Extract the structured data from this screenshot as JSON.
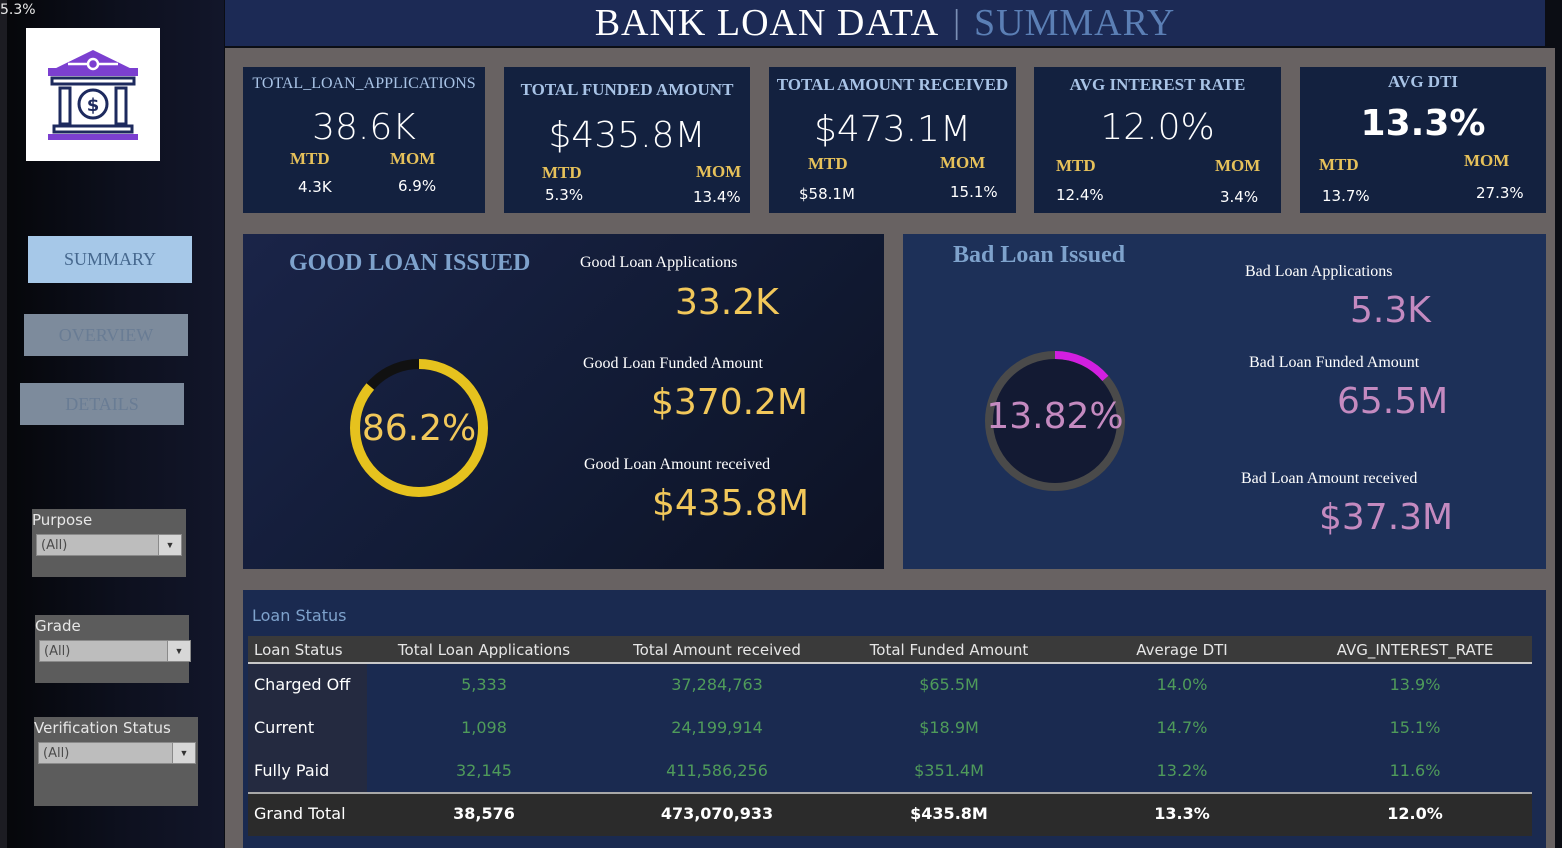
{
  "corner_text": "5.3%",
  "title": {
    "main": "BANK LOAN DATA",
    "separator": "|",
    "sub": "SUMMARY"
  },
  "nav": {
    "summary": "SUMMARY",
    "overview": "OVERVIEW",
    "details": "DETAILS"
  },
  "filters": [
    {
      "label": "Purpose",
      "value": "(All)"
    },
    {
      "label": "Grade",
      "value": "(All)"
    },
    {
      "label": "Verification Status",
      "value": "(All)"
    }
  ],
  "kpis": [
    {
      "title": "TOTAL_LOAN_APPLICATIONS",
      "value": "38.6K",
      "mtd_label": "MTD",
      "mom_label": "MOM",
      "mtd": "4.3K",
      "mom": "6.9%"
    },
    {
      "title": "TOTAL FUNDED AMOUNT",
      "value": "$435.8M",
      "mtd_label": "MTD",
      "mom_label": "MOM",
      "mtd": "5.3%",
      "mom": "13.4%"
    },
    {
      "title": "TOTAL AMOUNT RECEIVED",
      "value": "$473.1M",
      "mtd_label": "MTD",
      "mom_label": "MOM",
      "mtd": "$58.1M",
      "mom": "15.1%"
    },
    {
      "title": "AVG INTEREST RATE",
      "value": "12.0%",
      "mtd_label": "MTD",
      "mom_label": "MOM",
      "mtd": "12.4%",
      "mom": "3.4%"
    },
    {
      "title": "AVG DTI",
      "value": "13.3%",
      "mtd_label": "MTD",
      "mom_label": "MOM",
      "mtd": "13.7%",
      "mom": "27.3%"
    }
  ],
  "good": {
    "title": "GOOD LOAN ISSUED",
    "percent_label": "86.2%",
    "percent": 0.862,
    "apps_label": "Good Loan Applications",
    "apps": "33.2K",
    "funded_label": "Good Loan Funded Amount",
    "funded": "$370.2M",
    "received_label": "Good Loan Amount received",
    "received": "$435.8M",
    "ring_color": "#e6c21e",
    "track_color": "#111111"
  },
  "bad": {
    "title": "Bad Loan Issued",
    "percent_label": "13.82%",
    "percent": 0.1382,
    "apps_label": "Bad Loan Applications",
    "apps": "5.3K",
    "funded_label": "Bad Loan Funded Amount",
    "funded": "65.5M",
    "received_label": "Bad Loan Amount received",
    "received": "$37.3M",
    "ring_color": "#d21fe0",
    "track_color": "#4a4a4a"
  },
  "table": {
    "title": "Loan Status",
    "headers": [
      "Loan Status",
      "Total Loan Applications",
      "Total Amount received",
      "Total Funded Amount",
      "Average DTI",
      "AVG_INTEREST_RATE"
    ],
    "rows": [
      {
        "status": "Charged Off",
        "apps": "5,333",
        "received": "37,284,763",
        "funded": "$65.5M",
        "dti": "14.0%",
        "rate": "13.9%"
      },
      {
        "status": "Current",
        "apps": "1,098",
        "received": "24,199,914",
        "funded": "$18.9M",
        "dti": "14.7%",
        "rate": "15.1%"
      },
      {
        "status": "Fully Paid",
        "apps": "32,145",
        "received": "411,586,256",
        "funded": "$351.4M",
        "dti": "13.2%",
        "rate": "11.6%"
      }
    ],
    "grand": {
      "status": "Grand Total",
      "apps": "38,576",
      "received": "473,070,933",
      "funded": "$435.8M",
      "dti": "13.3%",
      "rate": "12.0%"
    }
  },
  "colors": {
    "accent_gold": "#e6c15a",
    "logo_purple": "#7b3fd0",
    "logo_navy": "#1d2a5e",
    "table_value_green": "#4f9b5a"
  }
}
